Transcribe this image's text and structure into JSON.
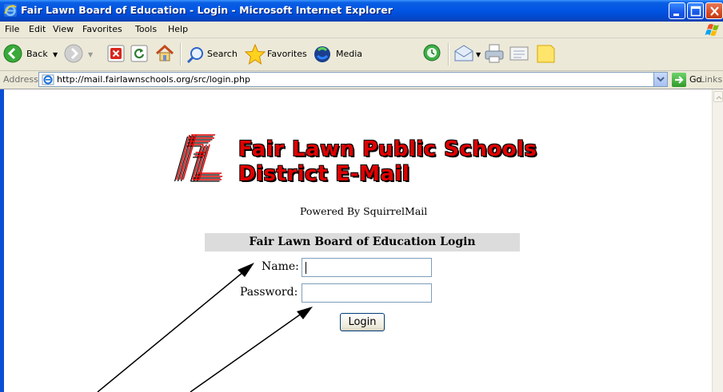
{
  "window": {
    "title": "Fair Lawn Board of Education - Login - Microsoft Internet Explorer",
    "title_bar_color": "#0054e3"
  },
  "menu": {
    "items": [
      "File",
      "Edit",
      "View",
      "Favorites",
      "Tools",
      "Help"
    ]
  },
  "toolbar": {
    "back_label": "Back",
    "search_label": "Search",
    "favorites_label": "Favorites",
    "media_label": "Media"
  },
  "address_bar": {
    "label": "Address",
    "url": "http://mail.fairlawnschools.org/src/login.php",
    "go_label": "Go",
    "links_label": "Links"
  },
  "page": {
    "logo_initials": "FL",
    "logo_line1": "Fair Lawn Public Schools",
    "logo_line2": "District E-Mail",
    "logo_color": "#e00000",
    "powered_by": "Powered By SquirrelMail",
    "login_title": "Fair Lawn Board of Education Login",
    "name_label": "Name:",
    "name_value": "",
    "password_label": "Password:",
    "password_value": "",
    "login_button": "Login"
  }
}
